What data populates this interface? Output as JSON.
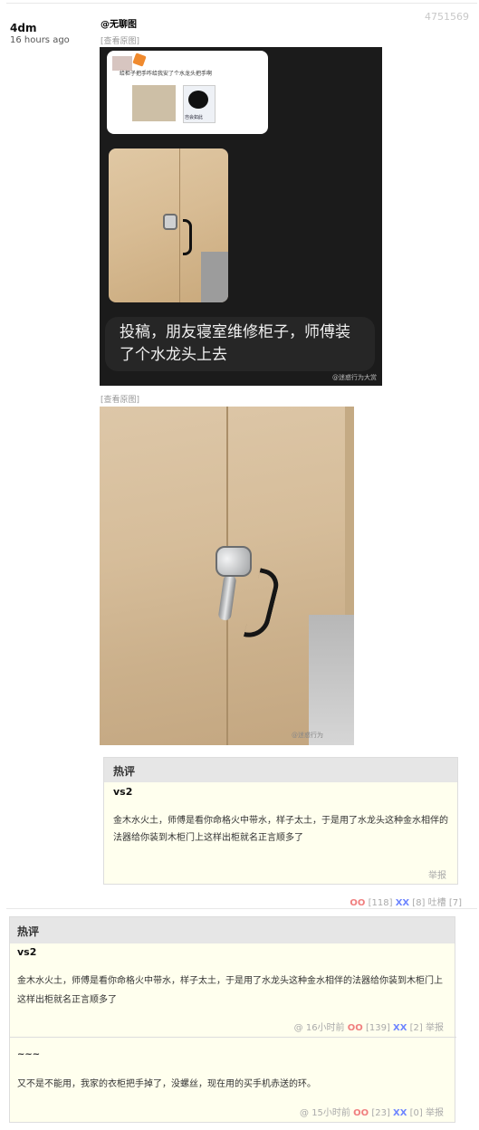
{
  "post": {
    "id": "4751569",
    "author": "4dm",
    "time": "16 hours ago",
    "title": "@无聊图",
    "view_original": "查看原图",
    "image1": {
      "tweet_text": "给柜子把手咋给我安了个水龙头把手啊",
      "meme_text": "岂会如此",
      "caption": "投稿，朋友寝室维修柜子，师傅装了个水龙头上去",
      "watermark": "@迷惑行为大赏"
    },
    "image2": {
      "watermark": "@迷惑行为"
    },
    "inner_hot": {
      "header": "热评",
      "name": "vs2",
      "body": "金木水火土，师傅是看你命格火中带水，样子太土，于是用了水龙头这种金水相伴的法器给你装到木柜门上这样出柜就名正言顺多了",
      "report": "举报"
    },
    "stats": {
      "oo_label": "OO",
      "oo_count": "[118]",
      "xx_label": "XX",
      "xx_count": "[8]",
      "tucao": "吐槽 [7]"
    }
  },
  "hot": {
    "header": "热评",
    "comments": [
      {
        "name": "vs2",
        "body": "金木水火土，师傅是看你命格火中带水，样子太土，于是用了水龙头这种金水相伴的法器给你装到木柜门上这样出柜就名正言顺多了",
        "at": "@",
        "time": "16小时前",
        "oo_label": "OO",
        "oo_count": "[139]",
        "xx_label": "XX",
        "xx_count": "[2]",
        "report": "举报"
      },
      {
        "name": "~~~",
        "body": "又不是不能用，我家的衣柜把手掉了，没螺丝，现在用的买手机赤送的环。",
        "at": "@",
        "time": "15小时前",
        "oo_label": "OO",
        "oo_count": "[23]",
        "xx_label": "XX",
        "xx_count": "[0]",
        "report": "举报"
      }
    ]
  },
  "colors": {
    "oo": "#f07f7f",
    "xx": "#6f86ff",
    "comment_bg": "#ffffee",
    "header_bg": "#e6e6e6"
  }
}
